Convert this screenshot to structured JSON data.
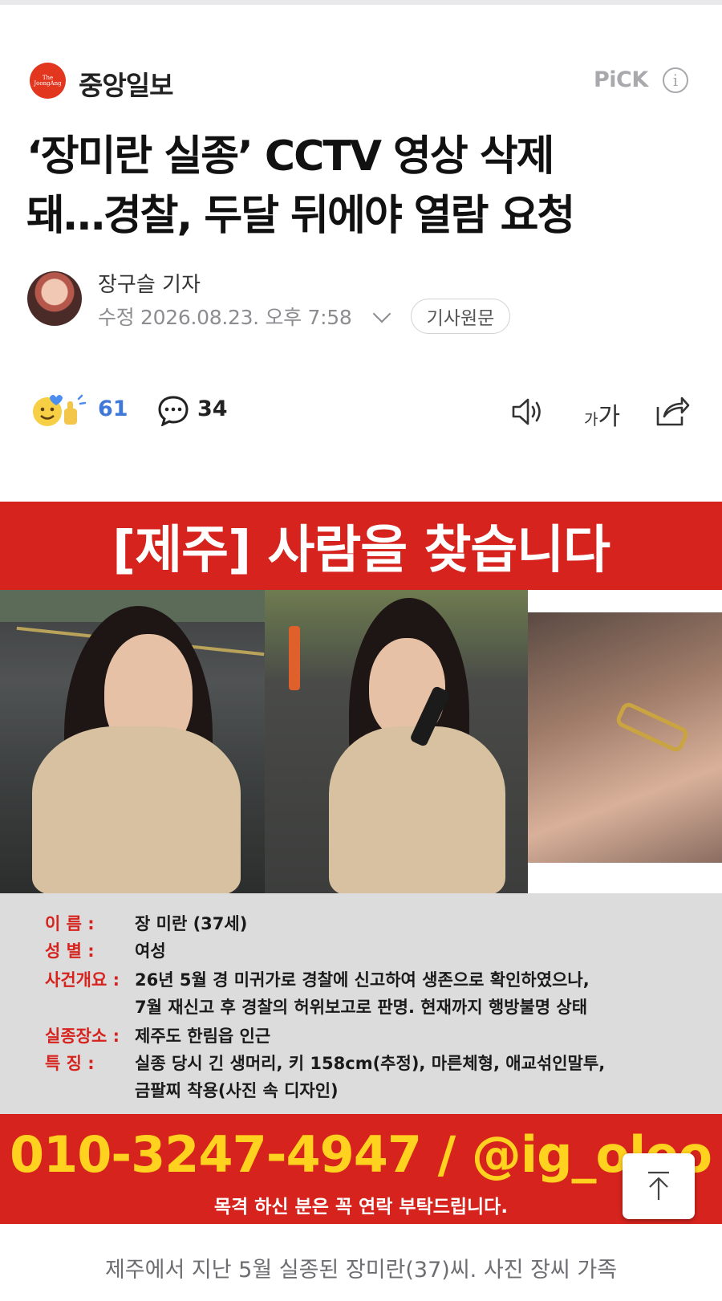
{
  "header": {
    "publisher_logo_text": "The JoongAng",
    "publisher_name": "중앙일보",
    "pick_label": "PiCK",
    "info_glyph": "i"
  },
  "article": {
    "headline_line1": "‘장미란 실종’ CCTV 영상 삭제",
    "headline_line2": "돼…경찰, 두달 뒤에야 열람 요청",
    "reporter": "장구슬 기자",
    "datetime": "수정 2026.08.23. 오후 7:58",
    "original_button": "기사원문"
  },
  "actions": {
    "reaction_count": "61",
    "comment_count": "34",
    "font_small": "가",
    "font_big": "가"
  },
  "poster": {
    "title": "[제주] 사람을 찾습니다",
    "fields": [
      {
        "label": "이     름 :",
        "value": "장 미란 (37세)"
      },
      {
        "label": "성     별 :",
        "value": "여성"
      },
      {
        "label": "사건개요 :",
        "value": "26년 5월 경 미귀가로 경찰에 신고하여 생존으로 확인하였으나,"
      },
      {
        "label": "",
        "value": "7월 재신고 후 경찰의 허위보고로 판명. 현재까지 행방불명 상태"
      },
      {
        "label": "실종장소 :",
        "value": "제주도 한림읍 인근"
      },
      {
        "label": "특     징 :",
        "value": "실종 당시 긴 생머리, 키 158cm(추정), 마른체형, 애교섞인말투,"
      },
      {
        "label": "",
        "value": "금팔찌 착용(사진 속 디자인)"
      }
    ],
    "contact": "010-3247-4947 / @ig_oleo",
    "contact_sub": "목격 하신 분은 꼭 연락 부탁드립니다."
  },
  "caption": "제주에서 지난 5월 실종된 장미란(37)씨. 사진 장씨 가족",
  "colors": {
    "brand_red": "#d6231d",
    "contact_yellow": "#ffd21f",
    "reaction_blue": "#3f78d8",
    "logo_red": "#e2361f"
  },
  "icons": [
    "info-icon",
    "chevron-down-icon",
    "reaction-icon",
    "comment-icon",
    "speaker-icon",
    "share-icon",
    "arrow-up-icon"
  ]
}
